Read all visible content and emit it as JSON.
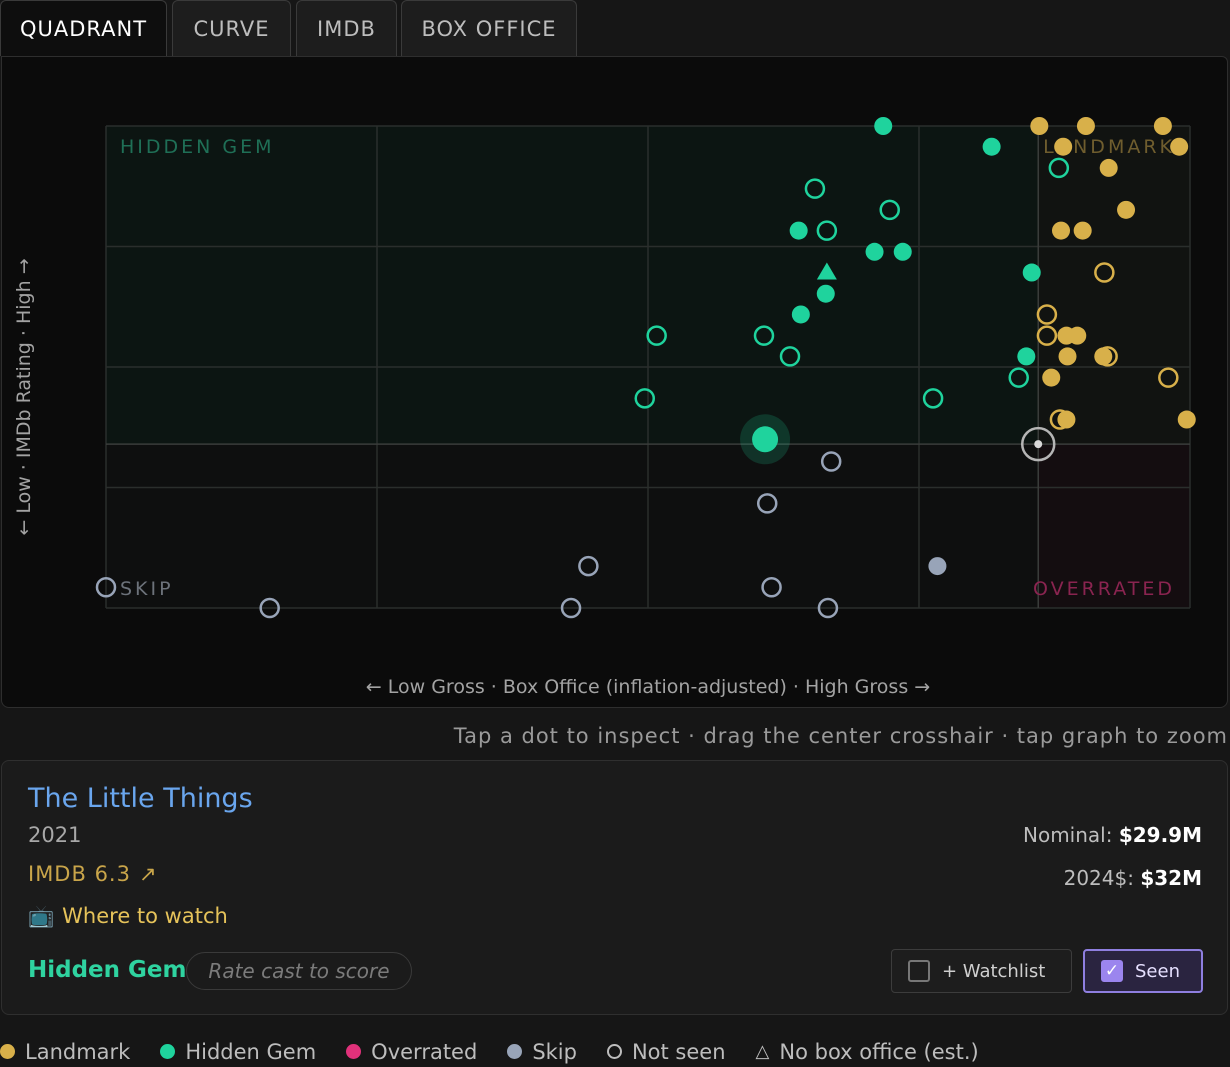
{
  "tabs": [
    "QUADRANT",
    "CURVE",
    "IMDB",
    "BOX OFFICE"
  ],
  "colors": {
    "landmark": "#d8b04a",
    "hidden_gem": "#1fd39d",
    "overrated": "#e0317a",
    "skip": "#98a4b8",
    "grid": "#2a2e2c"
  },
  "chart_data": {
    "type": "scatter",
    "xlabel": "← Low Gross · Box Office (inflation-adjusted) · High Gross →",
    "ylabel": "← Low · IMDb Rating · High →",
    "xlim": [
      0,
      1
    ],
    "ylim": [
      0,
      1
    ],
    "quadrant_labels": {
      "top_left": "HIDDEN GEM",
      "top_right": "LANDMARK",
      "bottom_left": "SKIP",
      "bottom_right": "OVERRATED"
    },
    "crosshair": {
      "x": 0.86,
      "y": 0.34
    },
    "grid": true,
    "selected": {
      "x": 0.608,
      "y": 0.35,
      "category": "hidden_gem"
    },
    "points": [
      {
        "x": 0.717,
        "y": 1.0,
        "c": "hidden_gem",
        "seen": true
      },
      {
        "x": 0.817,
        "y": 0.957,
        "c": "hidden_gem",
        "seen": true
      },
      {
        "x": 0.879,
        "y": 0.913,
        "c": "hidden_gem",
        "seen": false
      },
      {
        "x": 0.654,
        "y": 0.87,
        "c": "hidden_gem",
        "seen": false
      },
      {
        "x": 0.723,
        "y": 0.826,
        "c": "hidden_gem",
        "seen": false
      },
      {
        "x": 0.639,
        "y": 0.783,
        "c": "hidden_gem",
        "seen": true
      },
      {
        "x": 0.665,
        "y": 0.783,
        "c": "hidden_gem",
        "seen": false
      },
      {
        "x": 0.709,
        "y": 0.739,
        "c": "hidden_gem",
        "seen": true
      },
      {
        "x": 0.735,
        "y": 0.739,
        "c": "hidden_gem",
        "seen": true
      },
      {
        "x": 0.665,
        "y": 0.696,
        "c": "hidden_gem",
        "seen": true,
        "est": true
      },
      {
        "x": 0.854,
        "y": 0.696,
        "c": "hidden_gem",
        "seen": true
      },
      {
        "x": 0.664,
        "y": 0.652,
        "c": "hidden_gem",
        "seen": true
      },
      {
        "x": 0.641,
        "y": 0.609,
        "c": "hidden_gem",
        "seen": true
      },
      {
        "x": 0.508,
        "y": 0.565,
        "c": "hidden_gem",
        "seen": false
      },
      {
        "x": 0.607,
        "y": 0.565,
        "c": "hidden_gem",
        "seen": false
      },
      {
        "x": 0.631,
        "y": 0.522,
        "c": "hidden_gem",
        "seen": false
      },
      {
        "x": 0.849,
        "y": 0.522,
        "c": "hidden_gem",
        "seen": true
      },
      {
        "x": 0.842,
        "y": 0.478,
        "c": "hidden_gem",
        "seen": false
      },
      {
        "x": 0.497,
        "y": 0.435,
        "c": "hidden_gem",
        "seen": false
      },
      {
        "x": 0.763,
        "y": 0.435,
        "c": "hidden_gem",
        "seen": false
      },
      {
        "x": 0.861,
        "y": 1.0,
        "c": "landmark",
        "seen": true
      },
      {
        "x": 0.904,
        "y": 1.0,
        "c": "landmark",
        "seen": true
      },
      {
        "x": 0.975,
        "y": 1.0,
        "c": "landmark",
        "seen": true
      },
      {
        "x": 0.883,
        "y": 0.957,
        "c": "landmark",
        "seen": true
      },
      {
        "x": 0.99,
        "y": 0.957,
        "c": "landmark",
        "seen": true
      },
      {
        "x": 0.925,
        "y": 0.913,
        "c": "landmark",
        "seen": true
      },
      {
        "x": 0.941,
        "y": 0.826,
        "c": "landmark",
        "seen": true
      },
      {
        "x": 0.881,
        "y": 0.783,
        "c": "landmark",
        "seen": true
      },
      {
        "x": 0.901,
        "y": 0.783,
        "c": "landmark",
        "seen": true
      },
      {
        "x": 0.921,
        "y": 0.696,
        "c": "landmark",
        "seen": false
      },
      {
        "x": 0.868,
        "y": 0.609,
        "c": "landmark",
        "seen": false
      },
      {
        "x": 0.868,
        "y": 0.565,
        "c": "landmark",
        "seen": false
      },
      {
        "x": 0.886,
        "y": 0.565,
        "c": "landmark",
        "seen": true
      },
      {
        "x": 0.896,
        "y": 0.565,
        "c": "landmark",
        "seen": true
      },
      {
        "x": 0.887,
        "y": 0.522,
        "c": "landmark",
        "seen": true
      },
      {
        "x": 0.92,
        "y": 0.522,
        "c": "landmark",
        "seen": true
      },
      {
        "x": 0.924,
        "y": 0.522,
        "c": "landmark",
        "seen": false
      },
      {
        "x": 0.872,
        "y": 0.478,
        "c": "landmark",
        "seen": true
      },
      {
        "x": 0.98,
        "y": 0.478,
        "c": "landmark",
        "seen": false
      },
      {
        "x": 0.88,
        "y": 0.391,
        "c": "landmark",
        "seen": false
      },
      {
        "x": 0.886,
        "y": 0.391,
        "c": "landmark",
        "seen": true
      },
      {
        "x": 0.997,
        "y": 0.391,
        "c": "landmark",
        "seen": true
      },
      {
        "x": 0.669,
        "y": 0.304,
        "c": "skip",
        "seen": false
      },
      {
        "x": 0.61,
        "y": 0.217,
        "c": "skip",
        "seen": false
      },
      {
        "x": 0.445,
        "y": 0.087,
        "c": "skip",
        "seen": false
      },
      {
        "x": 0.767,
        "y": 0.087,
        "c": "skip",
        "seen": true
      },
      {
        "x": 0.0,
        "y": 0.043,
        "c": "skip",
        "seen": false
      },
      {
        "x": 0.614,
        "y": 0.043,
        "c": "skip",
        "seen": false
      },
      {
        "x": 0.151,
        "y": 0.0,
        "c": "skip",
        "seen": false
      },
      {
        "x": 0.429,
        "y": 0.0,
        "c": "skip",
        "seen": false
      },
      {
        "x": 0.666,
        "y": 0.0,
        "c": "skip",
        "seen": false
      }
    ]
  },
  "hint": "Tap a dot to inspect · drag the center crosshair · tap graph to zoom",
  "movie": {
    "title": "The Little Things",
    "year": "2021",
    "imdb": "IMDB 6.3",
    "imdb_arrow": "↗",
    "where_icon": "📺",
    "where_label": "Where to watch",
    "nominal_label": "Nominal:",
    "nominal_value": "$29.9M",
    "adjusted_label": "2024$:",
    "adjusted_value": "$32M",
    "category": "Hidden Gem",
    "rate_placeholder": "Rate cast to score",
    "watchlist_label": "+ Watchlist",
    "seen_label": "Seen",
    "seen_check": "✓"
  },
  "legend": [
    {
      "label": "Landmark",
      "icon": "dot",
      "color": "#d8b04a"
    },
    {
      "label": "Hidden Gem",
      "icon": "dot",
      "color": "#1fd39d"
    },
    {
      "label": "Overrated",
      "icon": "dot",
      "color": "#e0317a"
    },
    {
      "label": "Skip",
      "icon": "dot",
      "color": "#98a4b8"
    },
    {
      "label": "Not seen",
      "icon": "ring",
      "color": "#bdbdbd"
    },
    {
      "label": "No box office (est.)",
      "icon": "triangle",
      "color": "#bdbdbd"
    }
  ]
}
